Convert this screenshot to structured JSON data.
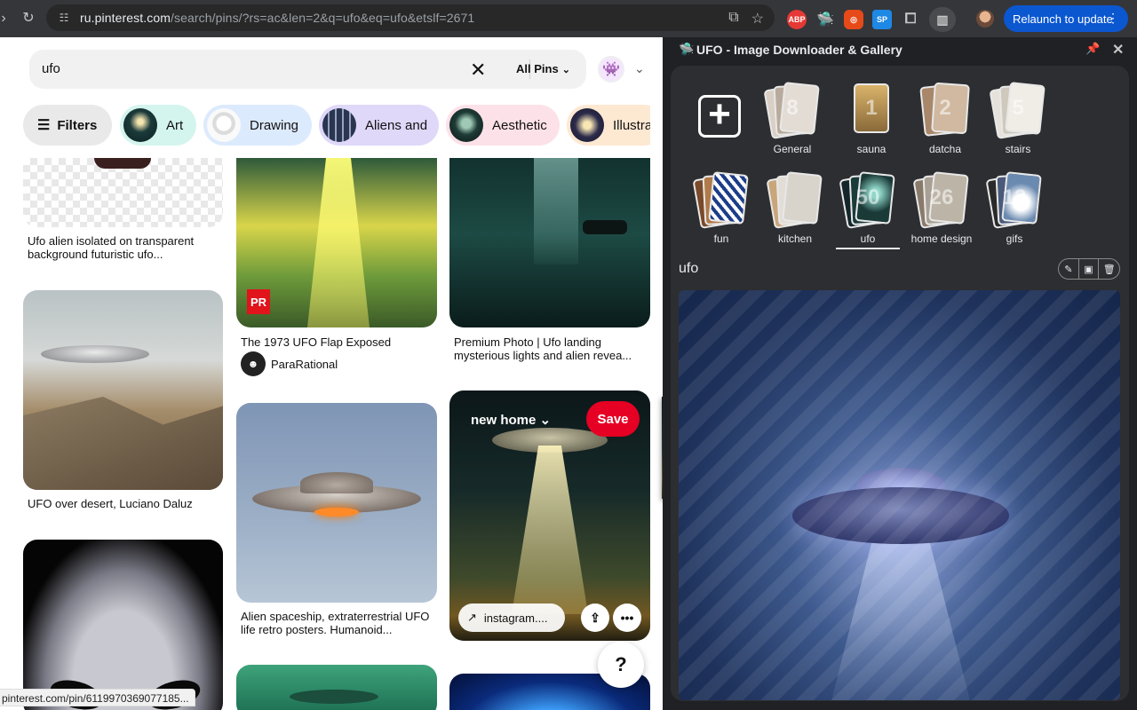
{
  "browser": {
    "url_main": "ru.pinterest.com",
    "url_rest": "/search/pins/?rs=ac&len=2&q=ufo&eq=ufo&etslf=2671",
    "relaunch_label": "Relaunch to update",
    "extensions": {
      "abp": "ABP",
      "sp": "SP"
    }
  },
  "pinterest": {
    "search_query": "ufo",
    "scope": "All Pins",
    "filters_label": "Filters",
    "chips": [
      "Art",
      "Drawing",
      "Aliens and",
      "Aesthetic",
      "Illustra"
    ],
    "pins": [
      {
        "title": "Ufo alien isolated on transparent background futuristic ufo..."
      },
      {
        "title": "UFO over desert, Luciano Daluz"
      },
      {
        "title": "The 1973 UFO Flap Exposed",
        "creator": "ParaRational",
        "badge": "PR"
      },
      {
        "title": "Alien spaceship, extraterrestrial UFO life retro posters. Humanoid..."
      },
      {
        "title": "Premium Photo | Ufo landing mysterious lights and alien revea..."
      },
      {
        "board": "new home",
        "save": "Save",
        "link": "instagram...."
      }
    ],
    "help": "?",
    "status_url": "pinterest.com/pin/6119970369077185..."
  },
  "side_panel": {
    "title": "UFO - Image Downloader & Gallery",
    "albums": [
      {
        "label": "General",
        "count": "8"
      },
      {
        "label": "sauna",
        "count": "1"
      },
      {
        "label": "datcha",
        "count": "2"
      },
      {
        "label": "stairs",
        "count": "5"
      },
      {
        "label": "fun",
        "count": ""
      },
      {
        "label": "kitchen",
        "count": ""
      },
      {
        "label": "ufo",
        "count": "50"
      },
      {
        "label": "home design",
        "count": "26"
      },
      {
        "label": "gifs",
        "count": "13"
      }
    ],
    "active_album": "ufo",
    "gallery_title": "ufo"
  },
  "colors": {
    "pinterest_red": "#e60023",
    "chrome_blue": "#0b57d0",
    "panel_bg": "#2d2e31"
  }
}
